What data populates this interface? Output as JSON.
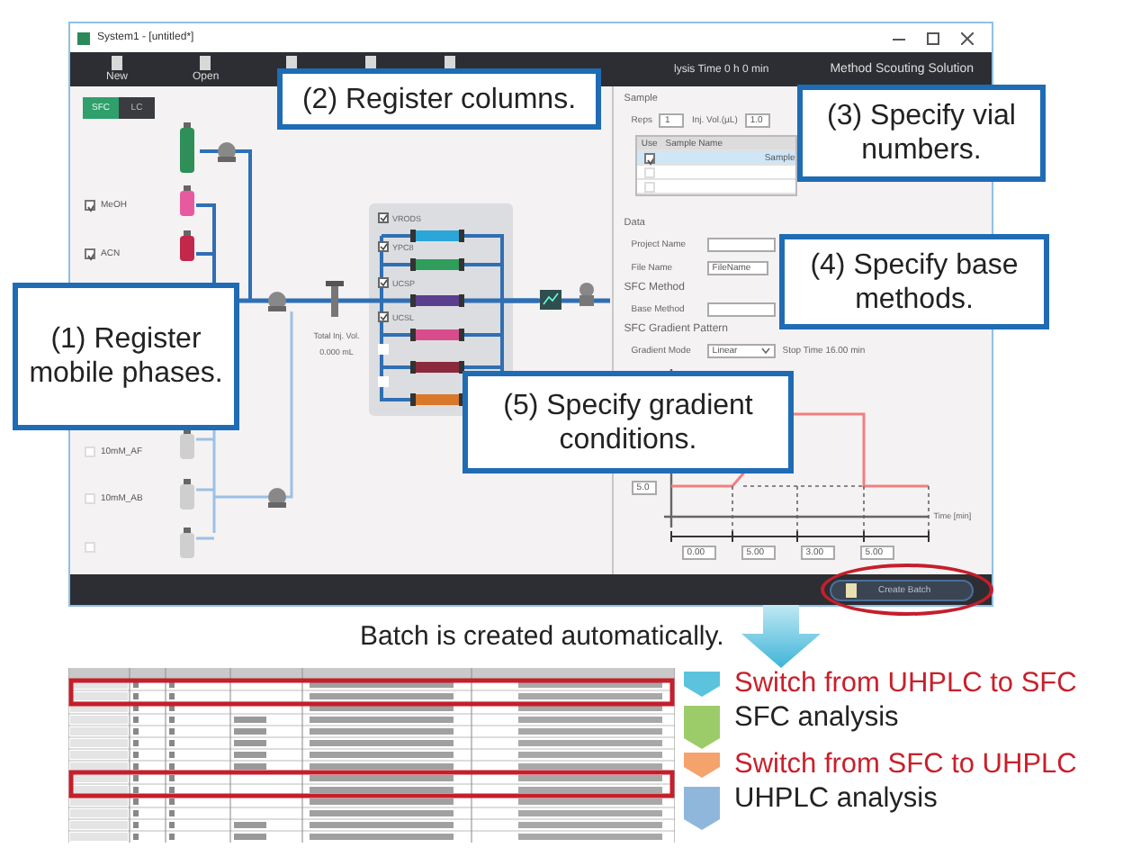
{
  "window": {
    "title": "System1 - [untitled*]",
    "toolbar": [
      {
        "kind": "labeled",
        "label": "New"
      },
      {
        "kind": "labeled",
        "label": "Open"
      },
      {
        "kind": "icon_only"
      },
      {
        "kind": "icon_only"
      },
      {
        "kind": "icon_only"
      }
    ],
    "analysis_time": "lysis Time 0 h 0 min",
    "product": "Method Scouting Solution"
  },
  "mode_toggle": [
    {
      "label": "SFC",
      "selected": true
    },
    {
      "label": "LC",
      "selected": false
    }
  ],
  "mobile_phases": [
    {
      "label": "MeOH",
      "checked": true
    },
    {
      "label": "ACN",
      "checked": true
    },
    {
      "label": "10mM_AF",
      "checked": false
    },
    {
      "label": "10mM_AB",
      "checked": false
    },
    {
      "checked": false
    }
  ],
  "injection": {
    "label": "Total Inj. Vol.",
    "value": "0.000 mL"
  },
  "columns": [
    {
      "label": "VRODS",
      "checked": true,
      "color": "#2aa7d8"
    },
    {
      "label": "YPC8",
      "checked": true,
      "color": "#2e9e5a"
    },
    {
      "label": "UCSP",
      "checked": true,
      "color": "#5b3f8f"
    },
    {
      "label": "UCSL",
      "checked": true,
      "color": "#d94c8c"
    },
    {
      "checked": false,
      "color": "#8b2a3c"
    },
    {
      "checked": false,
      "color": "#d9772a"
    }
  ],
  "sample": {
    "heading": "Sample",
    "reps_label": "Reps",
    "reps": "1",
    "inj_label": "Inj. Vol.(µL)",
    "inj": "1.0",
    "table_columns": [
      "Use",
      "Sample Name"
    ],
    "rows": [
      {
        "checked": true,
        "name": "Sample",
        "selected": true
      },
      {
        "checked": false,
        "selected": false
      },
      {
        "checked": false,
        "selected": false
      }
    ]
  },
  "data": {
    "heading": "Data",
    "project_label": "Project Name",
    "file_label": "File Name",
    "file": "FileName"
  },
  "sfc_method": {
    "heading": "SFC Method",
    "base_label": "Base Method"
  },
  "gradient": {
    "heading": "SFC Gradient Pattern",
    "mode_label": "Gradient Mode",
    "mode": "Linear",
    "stop_time": "Stop Time 16.00 min",
    "y_value": "5.0",
    "time_label": "Time [min]",
    "times": [
      "0.00",
      "5.00",
      "3.00",
      "5.00"
    ]
  },
  "create_button": "Create Batch",
  "callouts": [
    {
      "text": "(1) Register mobile phases.",
      "kind": "c1"
    },
    {
      "text": "(2) Register columns.",
      "kind": "c2"
    },
    {
      "text": "(3) Specify vial numbers.",
      "kind": "c3"
    },
    {
      "text": "(4) Specify base methods.",
      "kind": "c4"
    },
    {
      "text": "(5) Specify gradient conditions.",
      "kind": "c5"
    }
  ],
  "caption": "Batch is created automatically.",
  "legend": [
    {
      "text": "Switch from UHPLC to SFC",
      "kind": "switch",
      "color": "#5bc3dc"
    },
    {
      "text": "SFC analysis",
      "kind": "analysis",
      "color": "#9ccc6a"
    },
    {
      "text": "Switch from SFC to UHPLC",
      "kind": "switch",
      "color": "#f5a36c"
    },
    {
      "text": "UHPLC analysis",
      "kind": "analysis",
      "color": "#8fb7dc"
    }
  ]
}
